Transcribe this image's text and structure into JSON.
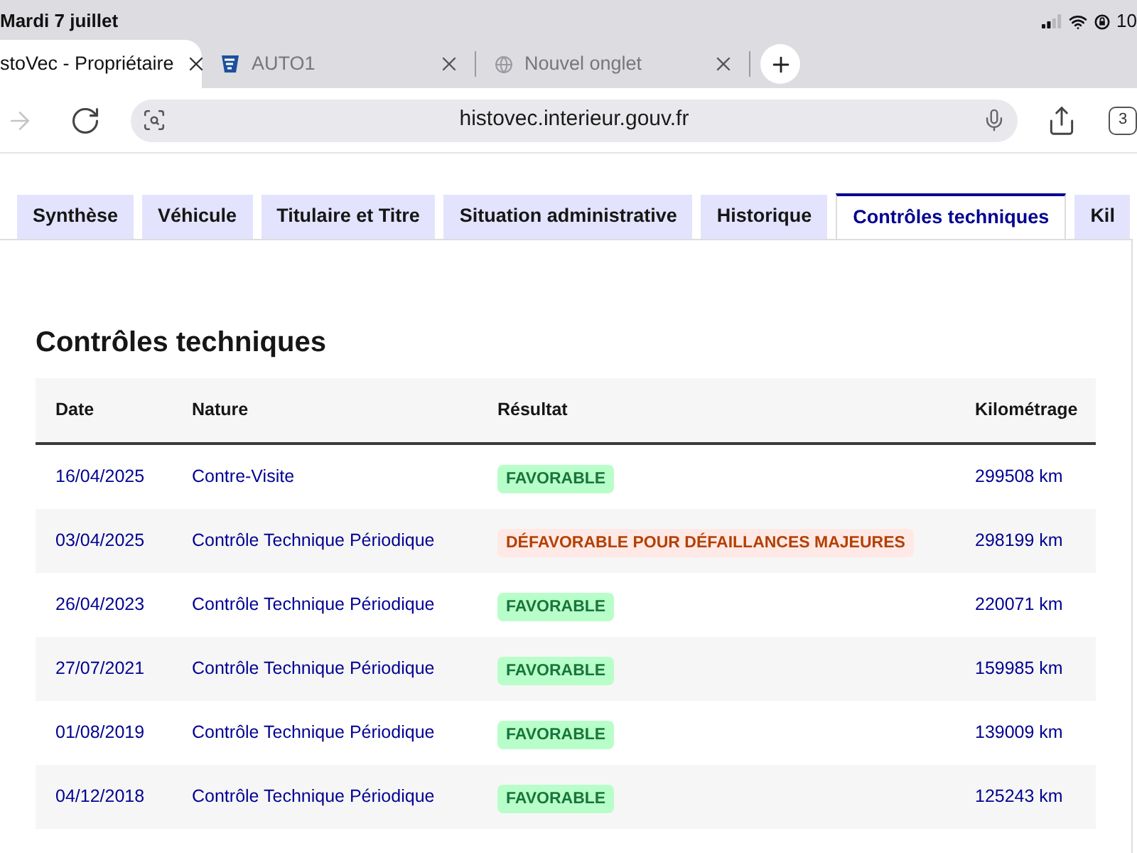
{
  "status_bar": {
    "date": "Mardi 7 juillet",
    "battery": "10"
  },
  "browser_tabs": [
    {
      "title": "stoVec - Propriétaire",
      "selected": true,
      "kind": "plain"
    },
    {
      "title": "AUTO1",
      "selected": false,
      "kind": "logo"
    },
    {
      "title": "Nouvel onglet",
      "selected": false,
      "kind": "globe"
    }
  ],
  "toolbar": {
    "forward": {
      "disabled": true
    },
    "url": "histovec.interieur.gouv.fr",
    "tab_count": "3"
  },
  "page_tabs": [
    {
      "label": "Synthèse",
      "selected": false
    },
    {
      "label": "Véhicule",
      "selected": false
    },
    {
      "label": "Titulaire et Titre",
      "selected": false
    },
    {
      "label": "Situation administrative",
      "selected": false
    },
    {
      "label": "Historique",
      "selected": false
    },
    {
      "label": "Contrôles techniques",
      "selected": true
    },
    {
      "label": "Kil",
      "selected": false
    }
  ],
  "section": {
    "title": "Contrôles techniques"
  },
  "table": {
    "columns": [
      "Date",
      "Nature",
      "Résultat",
      "Kilométrage"
    ],
    "rows": [
      {
        "date": "16/04/2025",
        "nature": "Contre-Visite",
        "result": "FAVORABLE",
        "kind": "favorable",
        "mileage": "299508 km"
      },
      {
        "date": "03/04/2025",
        "nature": "Contrôle Technique Périodique",
        "result": "DÉFAVORABLE POUR DÉFAILLANCES MAJEURES",
        "kind": "unfavorable",
        "mileage": "298199 km"
      },
      {
        "date": "26/04/2023",
        "nature": "Contrôle Technique Périodique",
        "result": "FAVORABLE",
        "kind": "favorable",
        "mileage": "220071 km"
      },
      {
        "date": "27/07/2021",
        "nature": "Contrôle Technique Périodique",
        "result": "FAVORABLE",
        "kind": "favorable",
        "mileage": "159985 km"
      },
      {
        "date": "01/08/2019",
        "nature": "Contrôle Technique Périodique",
        "result": "FAVORABLE",
        "kind": "favorable",
        "mileage": "139009 km"
      },
      {
        "date": "04/12/2018",
        "nature": "Contrôle Technique Périodique",
        "result": "FAVORABLE",
        "kind": "favorable",
        "mileage": "125243 km"
      }
    ]
  }
}
